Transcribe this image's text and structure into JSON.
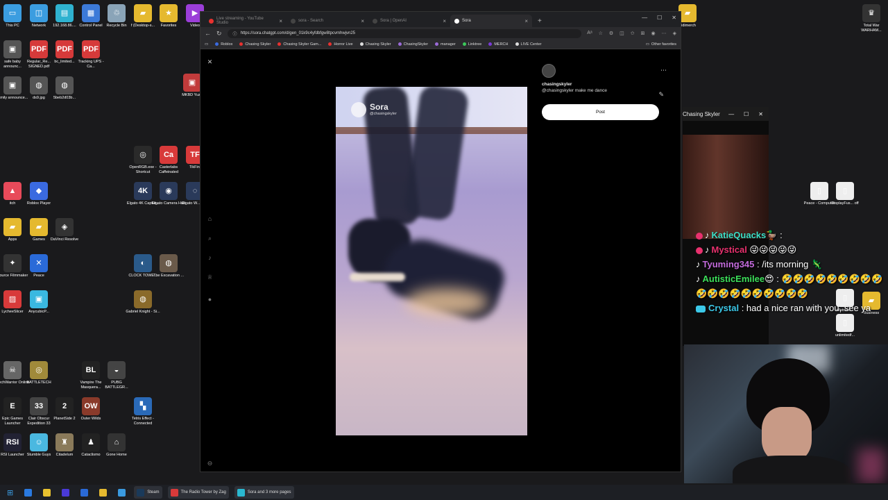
{
  "desktop": {
    "icons": [
      {
        "label": "This PC",
        "color": "#3b9de0",
        "glyph": "▭"
      },
      {
        "label": "Network",
        "color": "#3b9de0",
        "glyph": "◫"
      },
      {
        "label": "192.168.86....",
        "color": "#2fb2d0",
        "glyph": "▤"
      },
      {
        "label": "Control Panel",
        "color": "#3c7ad8",
        "glyph": "▦"
      },
      {
        "label": "Recycle Bin",
        "color": "#8aa4b8",
        "glyph": "♲"
      },
      {
        "label": "f (Desktop-s...",
        "color": "#e5b92f",
        "glyph": "▰"
      },
      {
        "label": "Favorites",
        "color": "#e5b92f",
        "glyph": "★"
      },
      {
        "label": "Video",
        "color": "#9b3ed8",
        "glyph": "▶"
      },
      {
        "label": "safe baby announc...",
        "color": "#555",
        "glyph": "▣"
      },
      {
        "label": "Regular_Re... SIGNED.pdf",
        "color": "#d63a3a",
        "glyph": "PDF"
      },
      {
        "label": "bc_limited...",
        "color": "#d63a3a",
        "glyph": "PDF"
      },
      {
        "label": "Tracking UPS - Ca...",
        "color": "#d63a3a",
        "glyph": "PDF"
      },
      {
        "label": "family announce...",
        "color": "#555",
        "glyph": "▣"
      },
      {
        "label": "ds9.jpg",
        "color": "#555",
        "glyph": "◍"
      },
      {
        "label": "5beb2d03b...",
        "color": "#555",
        "glyph": "◍"
      },
      {
        "label": "MKBD Yuzu",
        "color": "#c23b3b",
        "glyph": "▣"
      },
      {
        "label": "OpenRGB.exe - Shortcut",
        "color": "#2a2a2a",
        "glyph": "◎"
      },
      {
        "label": "Casterlabs Caffeinated",
        "color": "#d83a3a",
        "glyph": "Ca"
      },
      {
        "label": "TikFini",
        "color": "#d83a3a",
        "glyph": "TF"
      },
      {
        "label": "itch",
        "color": "#e84a5a",
        "glyph": "▲"
      },
      {
        "label": "Roblox Player",
        "color": "#3a6ae0",
        "glyph": "◆"
      },
      {
        "label": "Elgato 4K Captur...",
        "color": "#2a3a5a",
        "glyph": "4K"
      },
      {
        "label": "Elgato Camera Hub",
        "color": "#2a3a5a",
        "glyph": "◉"
      },
      {
        "label": "Elgato W... Link",
        "color": "#2a3a5a",
        "glyph": "◌"
      },
      {
        "label": "Apps",
        "color": "#e5b92f",
        "glyph": "▰"
      },
      {
        "label": "Games",
        "color": "#e5b92f",
        "glyph": "▰"
      },
      {
        "label": "DaVinci Resolve",
        "color": "#333",
        "glyph": "◈"
      },
      {
        "label": "Source Filmmaker",
        "color": "#333",
        "glyph": "✦"
      },
      {
        "label": "Peace",
        "color": "#2a6ad8",
        "glyph": "✕"
      },
      {
        "label": "CLOCK TOWE...",
        "color": "#2a5a8a",
        "glyph": "◐"
      },
      {
        "label": "The Excavation ...",
        "color": "#6a5a4a",
        "glyph": "◍"
      },
      {
        "label": "LycheeSlicer",
        "color": "#d83a3a",
        "glyph": "▨"
      },
      {
        "label": "AnycubicP...",
        "color": "#3ab8e0",
        "glyph": "▣"
      },
      {
        "label": "Gabriel Knight - Si...",
        "color": "#8a6a2a",
        "glyph": "◍"
      },
      {
        "label": "MechWarrior Online",
        "color": "#666",
        "glyph": "☠"
      },
      {
        "label": "BATTLETECH",
        "color": "#a08a3a",
        "glyph": "◎"
      },
      {
        "label": "Vampire The Masquera...",
        "color": "#222",
        "glyph": "BL"
      },
      {
        "label": "PUBG BATTLEGR...",
        "color": "#444",
        "glyph": "◒"
      },
      {
        "label": "Epic Games Launcher",
        "color": "#222",
        "glyph": "E"
      },
      {
        "label": "Clair Obscur Expedition 33",
        "color": "#444",
        "glyph": "33"
      },
      {
        "label": "PlanetSide 2",
        "color": "#222",
        "glyph": "2"
      },
      {
        "label": "Outer Wilds",
        "color": "#8a3a2a",
        "glyph": "OW"
      },
      {
        "label": "Tetris Effect - Connected",
        "color": "#2a6ab8",
        "glyph": "▚"
      },
      {
        "label": "RSI Launcher",
        "color": "#223",
        "glyph": "RSI"
      },
      {
        "label": "Stumble Guys",
        "color": "#4ab8e0",
        "glyph": "☺"
      },
      {
        "label": "Citadelum",
        "color": "#8a7a5a",
        "glyph": "♜"
      },
      {
        "label": "Cataclismo",
        "color": "#222",
        "glyph": "♟"
      },
      {
        "label": "Gone Home",
        "color": "#333",
        "glyph": "⌂"
      },
      {
        "label": "Total War WARHAM...",
        "color": "#333",
        "glyph": "♛"
      },
      {
        "label": "bidimerch",
        "color": "#e5b92f",
        "glyph": "▰"
      },
      {
        "label": "Peace - Computer",
        "color": "#eee",
        "glyph": "▯"
      },
      {
        "label": "DisplayFus... off",
        "color": "#eee",
        "glyph": "▯"
      },
      {
        "label": "offstrobe...",
        "color": "#eee",
        "glyph": "▯"
      },
      {
        "label": "unlimitedf...",
        "color": "#eee",
        "glyph": "▯"
      },
      {
        "label": "Business",
        "color": "#e5b92f",
        "glyph": "▰"
      }
    ]
  },
  "browser": {
    "tabs": [
      {
        "label": "Live streaming - YouTube Studio",
        "color": "#e8312f",
        "active": false
      },
      {
        "label": "sora - Search",
        "color": "#444",
        "active": false
      },
      {
        "label": "Sora | OpenAI",
        "color": "#444",
        "active": false
      },
      {
        "label": "Sora",
        "color": "#fff",
        "active": true
      }
    ],
    "url": "https://sora.chatgpt.com/d/gen_01k9c4yfdbfgw8tpcvmhwjvn25",
    "bookmarks": [
      {
        "label": "Roblox",
        "color": "#3a6ae0"
      },
      {
        "label": "Chasing Skyler",
        "color": "#e8312f"
      },
      {
        "label": "Chasing Skyler Gam...",
        "color": "#e8312f"
      },
      {
        "label": "Horror Live",
        "color": "#e8312f"
      },
      {
        "label": "Chasing Skyler",
        "color": "#ddd"
      },
      {
        "label": "ChasingSkyler",
        "color": "#9b6ad8"
      },
      {
        "label": "manager",
        "color": "#9b6ad8"
      },
      {
        "label": "Linktree",
        "color": "#3cc85a"
      },
      {
        "label": "MERCH",
        "color": "#7a3ad8"
      },
      {
        "label": "LIVE Center",
        "color": "#ddd"
      }
    ],
    "other_favorites": "Other favorites"
  },
  "sora": {
    "watermark_name": "Sora",
    "watermark_handle": "@chasingskyler",
    "username": "chasingskyler",
    "prompt": "@chasingskyler make me dance",
    "post_label": "Post"
  },
  "chat_window": {
    "title": "Chasing Skyler"
  },
  "chat": {
    "messages": [
      {
        "user": "KatieQuacks",
        "text": "🦆 :",
        "user_class": "u1",
        "icon": "tt-badge"
      },
      {
        "user": "Mystical",
        "text": " 😜😜😜😜😜",
        "user_class": "u2",
        "icon": "tt-badge"
      },
      {
        "user": "Tyuming345",
        "text": " : /its morning 🦎",
        "user_class": "u3",
        "icon": "tt"
      },
      {
        "user": "AutisticEmilee",
        "text": "😍 : 🤣🤣🤣🤣🤣🤣🤣🤣🤣🤣🤣🤣🤣🤣🤣🤣🤣🤣🤣",
        "user_class": "u4",
        "icon": "tt"
      },
      {
        "user": "Crystal",
        "text": " : had a nice ran with you, see ya",
        "user_class": "u5",
        "icon": "yt"
      }
    ]
  },
  "taskbar": {
    "items": [
      {
        "label": "",
        "color": "#2a7ae0"
      },
      {
        "label": "",
        "color": "#e8c12f"
      },
      {
        "label": "",
        "color": "#4a3ad8"
      },
      {
        "label": "",
        "color": "#2a6ad8"
      },
      {
        "label": "",
        "color": "#e5b92f"
      },
      {
        "label": "",
        "color": "#3a9ae0"
      },
      {
        "label": "Steam",
        "color": "#1a3a5a"
      },
      {
        "label": "The Radio Tower by Zag",
        "color": "#d83a3a"
      },
      {
        "label": "Sora and 3 more pages",
        "color": "#2ab8d0"
      }
    ]
  }
}
